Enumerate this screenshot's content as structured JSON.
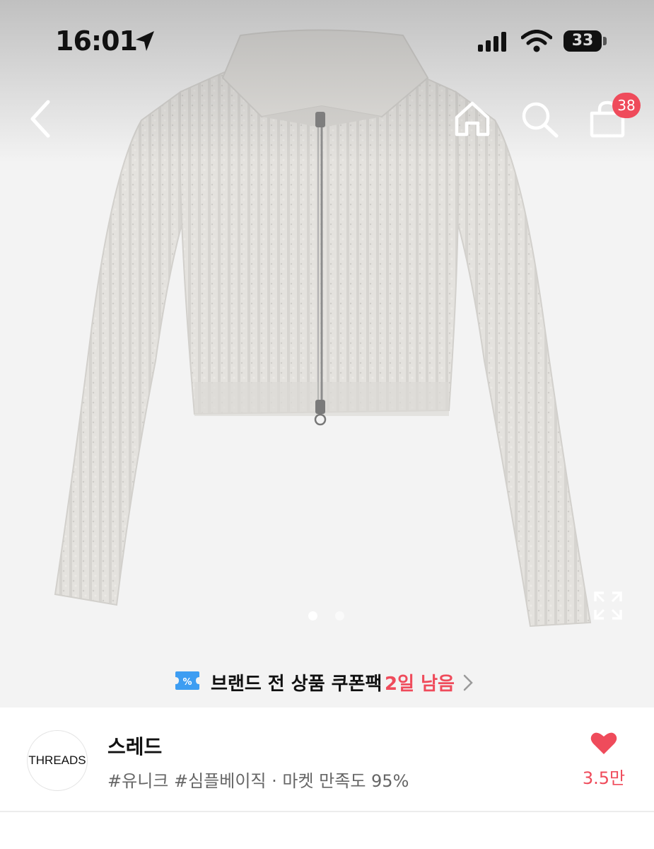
{
  "status_bar": {
    "time": "16:01",
    "battery": "33"
  },
  "nav": {
    "cart_badge": "38"
  },
  "product_images": {
    "current_index": 1,
    "total": 2
  },
  "coupon": {
    "text": "브랜드 전 상품 쿠폰팩",
    "remaining": "2일 남음"
  },
  "brand": {
    "logo_text": "THREADS",
    "name": "스레드",
    "tags": "#유니크 #심플베이직 · 마켓 만족도 95%",
    "likes": "3.5만"
  },
  "colors": {
    "accent": "#ef4b5b",
    "coupon_icon": "#3d9df2"
  }
}
